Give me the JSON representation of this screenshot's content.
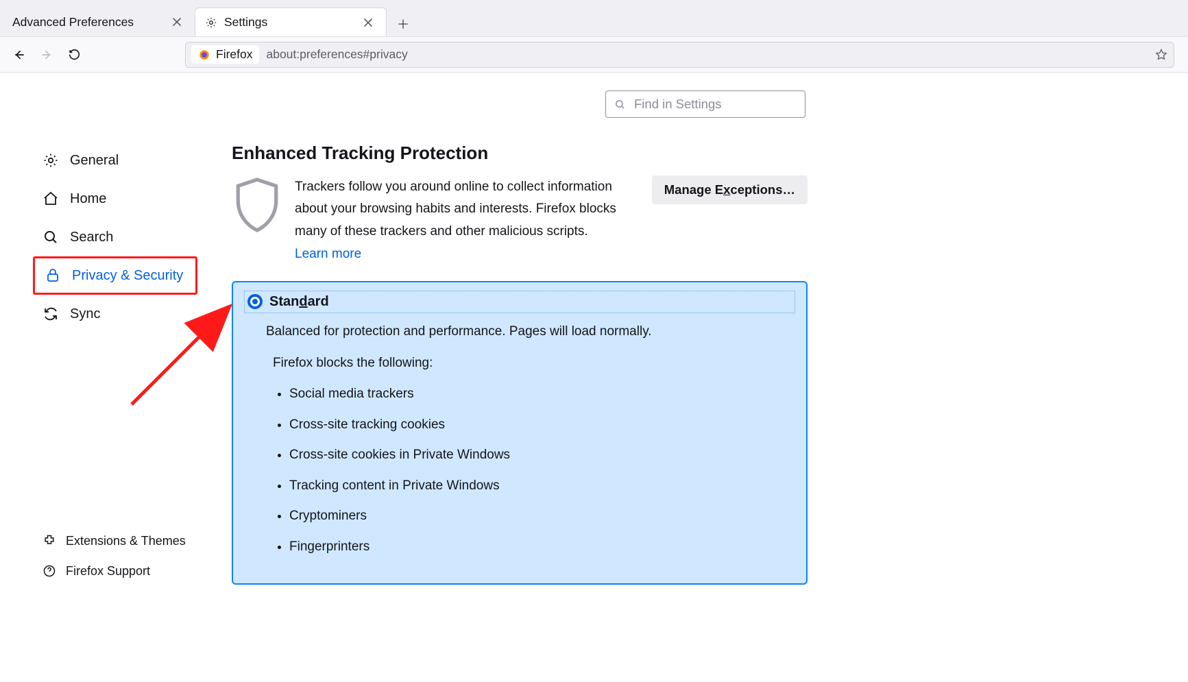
{
  "tabs": {
    "t0": "Advanced Preferences",
    "t1": "Settings"
  },
  "url": {
    "identity": "Firefox",
    "value": "about:preferences#privacy"
  },
  "find_placeholder": "Find in Settings",
  "sidebar": {
    "general": "General",
    "home": "Home",
    "search": "Search",
    "privacy": "Privacy & Security",
    "sync": "Sync",
    "ext": "Extensions & Themes",
    "support": "Firefox Support"
  },
  "etp": {
    "title": "Enhanced Tracking Protection",
    "desc": "Trackers follow you around online to collect information about your browsing habits and interests. Firefox blocks many of these trackers and other malicious scripts.",
    "learn": "Learn more",
    "manage": "Manage Exceptions…",
    "standard": {
      "label_pre": "Stan",
      "label_ul": "d",
      "label_post": "ard",
      "desc": "Balanced for protection and performance. Pages will load normally.",
      "blocks_heading": "Firefox blocks the following:",
      "items": {
        "i0": "Social media trackers",
        "i1": "Cross-site tracking cookies",
        "i2": "Cross-site cookies in Private Windows",
        "i3": "Tracking content in Private Windows",
        "i4": "Cryptominers",
        "i5": "Fingerprinters"
      }
    }
  }
}
